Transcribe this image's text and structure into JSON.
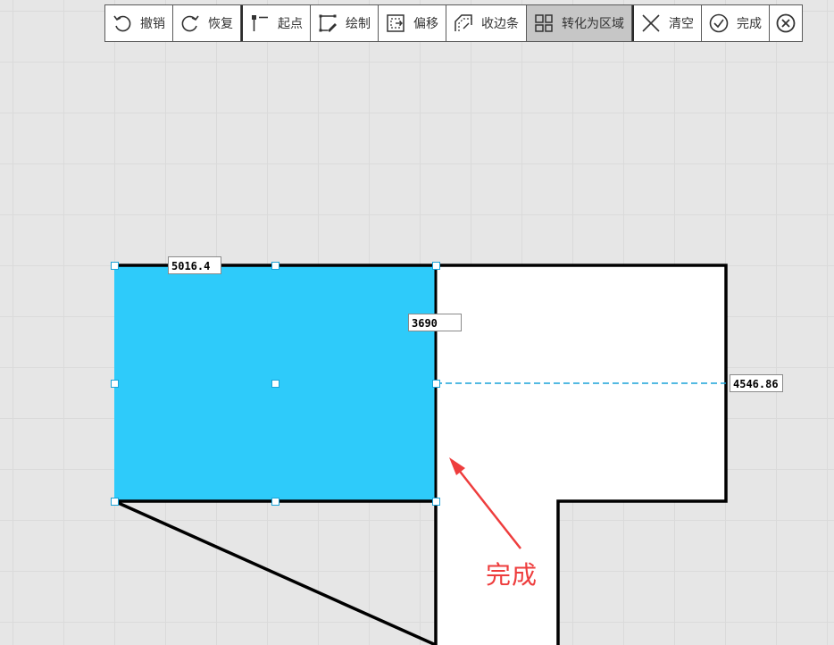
{
  "toolbar": {
    "undo": "撤销",
    "redo": "恢复",
    "start_point": "起点",
    "draw": "绘制",
    "offset": "偏移",
    "edge_strip": "收边条",
    "to_region": "转化为区域",
    "clear": "清空",
    "done": "完成",
    "active_tool": "to_region"
  },
  "dimensions": {
    "top_width": "5016.4",
    "inner_height": "3690",
    "right_offset": "4546.86"
  },
  "annotation": {
    "text": "完成",
    "color": "#ee3d3d"
  },
  "colors": {
    "selected_fill": "#2ecbfa",
    "room_fill": "#ffffff",
    "wall_stroke": "#000000",
    "guide_line": "#1aa3d8",
    "handle_border": "#1aa3d8"
  },
  "icons": [
    "undo-icon",
    "redo-icon",
    "start-point-icon",
    "draw-icon",
    "offset-icon",
    "edge-strip-icon",
    "region-icon",
    "clear-icon",
    "done-icon",
    "close-icon"
  ]
}
